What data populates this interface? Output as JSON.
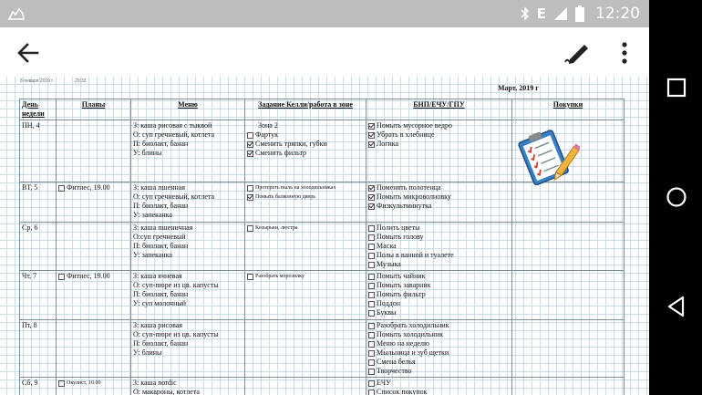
{
  "status_bar": {
    "network": "E",
    "time": "12:20"
  },
  "toolbar": {
    "back_icon": "arrow-left-icon",
    "edit_icon": "edit-pen-icon",
    "more_icon": "more-vert-icon"
  },
  "document": {
    "print_date": "8 января 2019 г.",
    "print_time": "20:33",
    "month_title": "Март, 2019 г",
    "headers": {
      "day": "День недели",
      "plans": "Планы",
      "menu": "Меню",
      "kelly": "Задание Келли/работа в зоне",
      "bnp": "БНП/ЕЧУ/ГПУ",
      "shopping": "Покупки"
    },
    "rows": [
      {
        "day": "ПН, 4",
        "plans": [],
        "menu": [
          "З: каша рисовая с тыквой",
          "О: суп гречневый, котлета",
          "П: биолакт, банан",
          "У: блины"
        ],
        "kelly": [
          {
            "text": "Зона 2",
            "zone": true
          },
          {
            "text": "Фартук",
            "checked": false
          },
          {
            "text": "Сменить тряпки, губки",
            "checked": true
          },
          {
            "text": "Сменить фильтр",
            "checked": true
          }
        ],
        "bnp": [
          {
            "text": "Помыть мусорное ведро",
            "checked": true
          },
          {
            "text": "Убрать в хлебнице",
            "checked": true
          },
          {
            "text": "Логика",
            "checked": true
          }
        ]
      },
      {
        "day": "ВТ, 5",
        "plans": [
          {
            "text": "Фитнес, 19.00",
            "checked": false
          }
        ],
        "menu": [
          "З: каша пшенная",
          "О: суп гречневый, котлета",
          "П: биолакт, банан",
          "У: запеканка"
        ],
        "kelly": [
          {
            "text": "Протереть пыль на холодильниках",
            "checked": false
          },
          {
            "text": "Помыть балконную дверь",
            "checked": true
          }
        ],
        "bnp": [
          {
            "text": "Поменять полотенца",
            "checked": true
          },
          {
            "text": "Помыть микроволновку",
            "checked": true
          },
          {
            "text": "Физкультминутка",
            "checked": true
          }
        ]
      },
      {
        "day": "Ср, 6",
        "plans": [],
        "menu": [
          "З: каша пшеничная",
          "О:суп гречневый",
          "П: биолакт, банан",
          "У: запеканка"
        ],
        "kelly": [
          {
            "text": "Козырьки, люстра",
            "checked": false
          }
        ],
        "bnp": [
          {
            "text": "Полить цветы",
            "checked": false
          },
          {
            "text": "Помыть голову",
            "checked": false
          },
          {
            "text": "Маска",
            "checked": false
          },
          {
            "text": "Полы в ванной и туалете",
            "checked": false
          },
          {
            "text": "Музыка",
            "checked": false
          }
        ]
      },
      {
        "day": "Чт, 7",
        "plans": [
          {
            "text": "Фитнес, 19.00",
            "checked": false
          }
        ],
        "menu": [
          "З: каша ячневая",
          "О: суп-пюре из цв. капусты",
          "П: биолакт, банан",
          "У: суп молочный"
        ],
        "kelly": [
          {
            "text": "Разобрать морозилку",
            "checked": false
          }
        ],
        "bnp": [
          {
            "text": "Помыть чайник",
            "checked": false
          },
          {
            "text": "Помыть заварник",
            "checked": false
          },
          {
            "text": "Помыть фильтр",
            "checked": false
          },
          {
            "text": "Поддон",
            "checked": false
          },
          {
            "text": "Буквы",
            "checked": false
          }
        ]
      },
      {
        "day": "Пт, 8",
        "plans": [],
        "menu": [
          "З: каша рисовая",
          "О: суп-пюре из цв. капусты",
          "П: биолакт, банан",
          "У: блины"
        ],
        "kelly": [],
        "bnp": [
          {
            "text": "Разобрать холодильник",
            "checked": false
          },
          {
            "text": "Помыть холодильник",
            "checked": false
          },
          {
            "text": "Меню на неделю",
            "checked": false
          },
          {
            "text": "Мыльница и зуб щетки",
            "checked": false
          },
          {
            "text": "Смена белья",
            "checked": false
          },
          {
            "text": "Творчество",
            "checked": false
          }
        ]
      },
      {
        "day": "Сб, 9",
        "plans": [
          {
            "text": "Окулист, 10.00",
            "checked": false
          }
        ],
        "menu": [
          "З: каша nordic",
          "О: макароны, котлета"
        ],
        "kelly": [],
        "bnp": [
          {
            "text": "ЕЧУ",
            "checked": false
          },
          {
            "text": "Список покупок",
            "checked": false
          }
        ]
      }
    ],
    "clipart_icon": "checklist-clipboard-icon"
  },
  "nav_bar": {
    "recents_icon": "recents-square-icon",
    "home_icon": "home-circle-icon",
    "back_icon": "back-triangle-icon"
  },
  "colors": {
    "status_bar": "#bdbdbd",
    "grid_line": "#c9dde8",
    "nav_bar": "#000000"
  }
}
